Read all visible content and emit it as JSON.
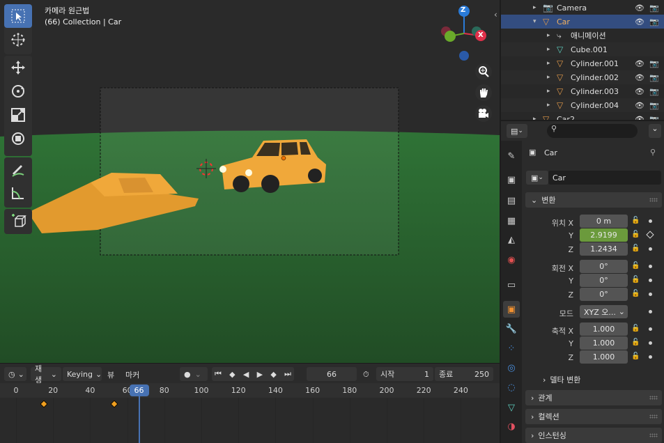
{
  "viewport": {
    "camera_label": "카메라 원근법",
    "collection_label": "(66) Collection | Car",
    "axis": {
      "z": "Z",
      "x": "X"
    }
  },
  "toolbar": {
    "tools": [
      "select-box-icon",
      "cursor-icon",
      "move-icon",
      "rotate-icon",
      "scale-icon",
      "transform-icon",
      "annotate-icon",
      "measure-icon",
      "add-cube-icon"
    ]
  },
  "timeline": {
    "playback_label": "재생",
    "keying_label": "Keying",
    "view_label": "뷰",
    "marker_label": "마커",
    "current_frame": "66",
    "start_label": "시작",
    "start_value": "1",
    "end_label": "종료",
    "end_value": "250",
    "ruler_ticks": [
      "0",
      "20",
      "40",
      "60",
      "80",
      "100",
      "120",
      "140",
      "160",
      "180",
      "200",
      "220",
      "240"
    ],
    "keyframes": [
      15,
      53
    ]
  },
  "outliner": {
    "rows": [
      {
        "label": "Camera",
        "icon": "camera-icon",
        "expanded": false
      },
      {
        "label": "Car",
        "icon": "object-icon",
        "expanded": true,
        "selected": true
      },
      {
        "label": "애니메이션",
        "icon": "action-icon"
      },
      {
        "label": "Cube.001",
        "icon": "mesh-icon"
      },
      {
        "label": "Cylinder.001",
        "icon": "object-icon"
      },
      {
        "label": "Cylinder.002",
        "icon": "object-icon"
      },
      {
        "label": "Cylinder.003",
        "icon": "object-icon"
      },
      {
        "label": "Cylinder.004",
        "icon": "object-icon"
      },
      {
        "label": "Car2",
        "icon": "object-icon"
      }
    ]
  },
  "properties": {
    "object_name": "Car",
    "name_field": "Car",
    "transform_header": "변환",
    "location_label": "위치 X",
    "loc_y_label": "Y",
    "loc_z_label": "Z",
    "loc_x": "0 m",
    "loc_y": "2.9199",
    "loc_z": "1.2434",
    "rotation_label": "회전 X",
    "rot_y_label": "Y",
    "rot_z_label": "Z",
    "rot_x": "0°",
    "rot_y": "0°",
    "rot_z": "0°",
    "mode_label": "모드",
    "mode_value": "XYZ 오...",
    "scale_label": "축적 X",
    "scale_y_label": "Y",
    "scale_z_label": "Z",
    "scale_x": "1.000",
    "scale_y": "1.000",
    "scale_z": "1.000",
    "delta_label": "델타 변환",
    "relations_label": "관계",
    "collections_label": "컬렉션",
    "instancing_label": "인스턴싱"
  },
  "colors": {
    "accent": "#4772b3",
    "keyframe": "#f0a020",
    "green_field": "#6b9a3c",
    "ground": "#2e6a34"
  }
}
